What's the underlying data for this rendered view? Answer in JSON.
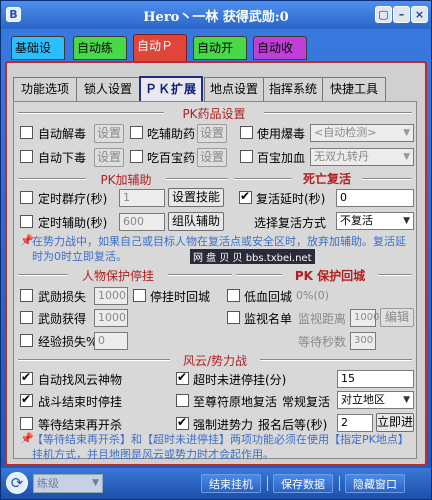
{
  "window": {
    "title": "Hero丶一林 获得武勋:0",
    "logo": "B",
    "btn_menu": "▢",
    "btn_min": "–",
    "btn_close": "×"
  },
  "main_tabs": [
    {
      "label": "基础设置",
      "color": "#2cbfff"
    },
    {
      "label": "自动练级",
      "color": "#48d848"
    },
    {
      "label": "自动ＰＫ",
      "color": "#e0453a"
    },
    {
      "label": "自动开店",
      "color": "#48d848"
    },
    {
      "label": "自动收货",
      "color": "#c03fd8"
    }
  ],
  "sub_tabs": [
    "功能选项",
    "锁人设置",
    "ＰＫ扩展",
    "地点设置",
    "指挥系统",
    "快捷工具"
  ],
  "pk_drugs": {
    "title": "PK药品设置",
    "auto_unpoison": "自动解毒",
    "auto_unpoison_btn": "设置",
    "eat_aux": "吃辅助药",
    "eat_aux_btn": "设置",
    "use_explode": "使用爆毒",
    "explode_option": "<自动检测>",
    "auto_undress": "自动下毒",
    "auto_undress_btn": "设置",
    "eat_treasure": "吃百宝药",
    "eat_treasure_btn": "设置",
    "baibao_add": "百宝加血",
    "baibao_option": "无双九转丹"
  },
  "pk_assist": {
    "title": "PK加辅助",
    "timed_group": "定时群疗(秒)",
    "timed_group_val": "1",
    "set_skill_btn": "设置技能",
    "timed_assist": "定时辅助(秒)",
    "timed_assist_val": "600",
    "group_assist_btn": "组队辅助"
  },
  "revive": {
    "title": "死亡复活",
    "delay": "复活延时(秒)",
    "delay_val": "0",
    "method_label": "选择复活方式",
    "method_val": "不复活"
  },
  "note1": "在势力战中，如果自己或目标人物在复活点或安全区时，放弃加辅助。复活延时为0时立即复活。",
  "watermark": "网 盘 贝 贝 bbs.txbei.net",
  "protect": {
    "title": "人物保护停挂",
    "weapon_loss": "武勋损失",
    "weapon_loss_val": "1000",
    "stop_return": "停挂时回城",
    "weapon_gain": "武勋获得",
    "weapon_gain_val": "1000",
    "exp_loss": "经验损失%",
    "exp_loss_val": "0"
  },
  "pk_protect": {
    "title": "PK 保护回城",
    "low_return": "低血回城",
    "low_return_val": "0%(0)",
    "monitor": "监视名单",
    "monitor_dist": "监视距离",
    "monitor_dist_val": "1000",
    "edit_btn": "编辑",
    "wait_label": "等待秒数",
    "wait_val": "300"
  },
  "war": {
    "title": "风云/势力战",
    "auto_find": "自动找风云神物",
    "timeout": "超时未进停挂(分)",
    "timeout_val": "15",
    "battle_end_stop": "战斗结束时停挂",
    "revive_origin": "至尊符原地复活",
    "normal_revive": "常规复活",
    "normal_revive_val": "对立地区",
    "wait_end_open": "等待结束再开杀",
    "force_join": "强制进势力",
    "signup_wait": "报名后等(秒)",
    "signup_wait_val": "2",
    "now_btn": "立即进"
  },
  "note2": "【等待结束再开杀】和【超时未进停挂】两项功能必须在使用【指定PK地点】挂机方式，并且地图是风云或势力时才会起作用。",
  "statusbar": {
    "select": "练级",
    "btn_end": "结束挂机",
    "btn_save": "保存数据",
    "btn_hide": "隐藏窗口"
  }
}
